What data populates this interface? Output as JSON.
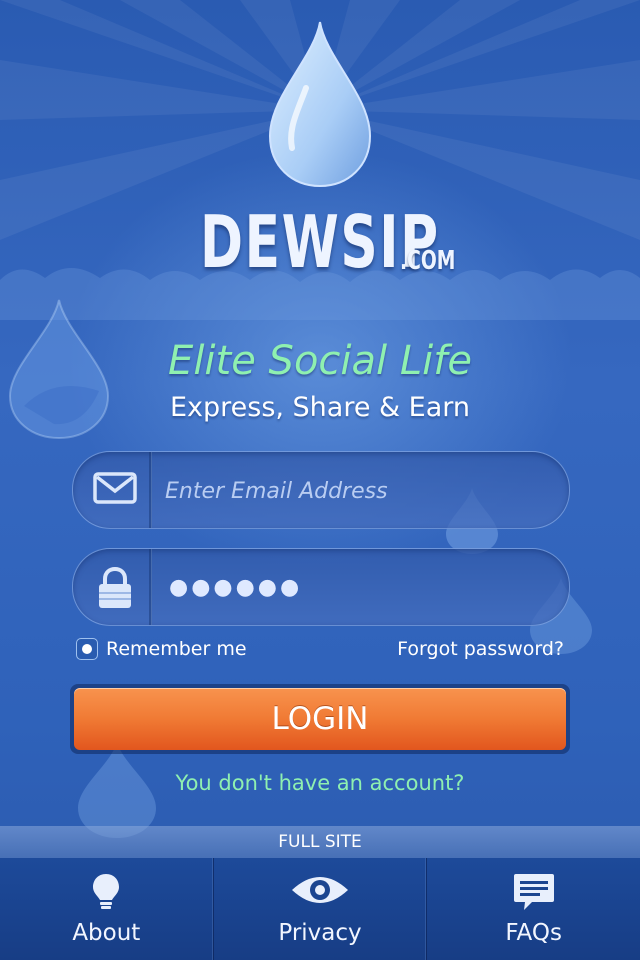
{
  "brand": {
    "name": "DEWSIP",
    "tld": ".COM"
  },
  "tagline": "Elite Social Life",
  "subtagline": "Express, Share & Earn",
  "login_form": {
    "email_placeholder": "Enter Email Address",
    "password_masked": "●●●●●●",
    "remember_label": "Remember me",
    "remember_checked": true,
    "forgot_link": "Forgot password?",
    "login_button": "LOGIN"
  },
  "signup_link": "You don't have an account?",
  "full_site_link": "FULL SITE",
  "tabbar": {
    "items": [
      {
        "label": "About",
        "icon": "lightbulb-icon"
      },
      {
        "label": "Privacy",
        "icon": "eye-icon"
      },
      {
        "label": "FAQs",
        "icon": "chat-bubble-icon"
      }
    ]
  },
  "colors": {
    "background": "#2a5fb8",
    "tagline_green": "#8ff0b0",
    "login_orange": "#f07a34",
    "tabbar": "#1d4a9a"
  }
}
